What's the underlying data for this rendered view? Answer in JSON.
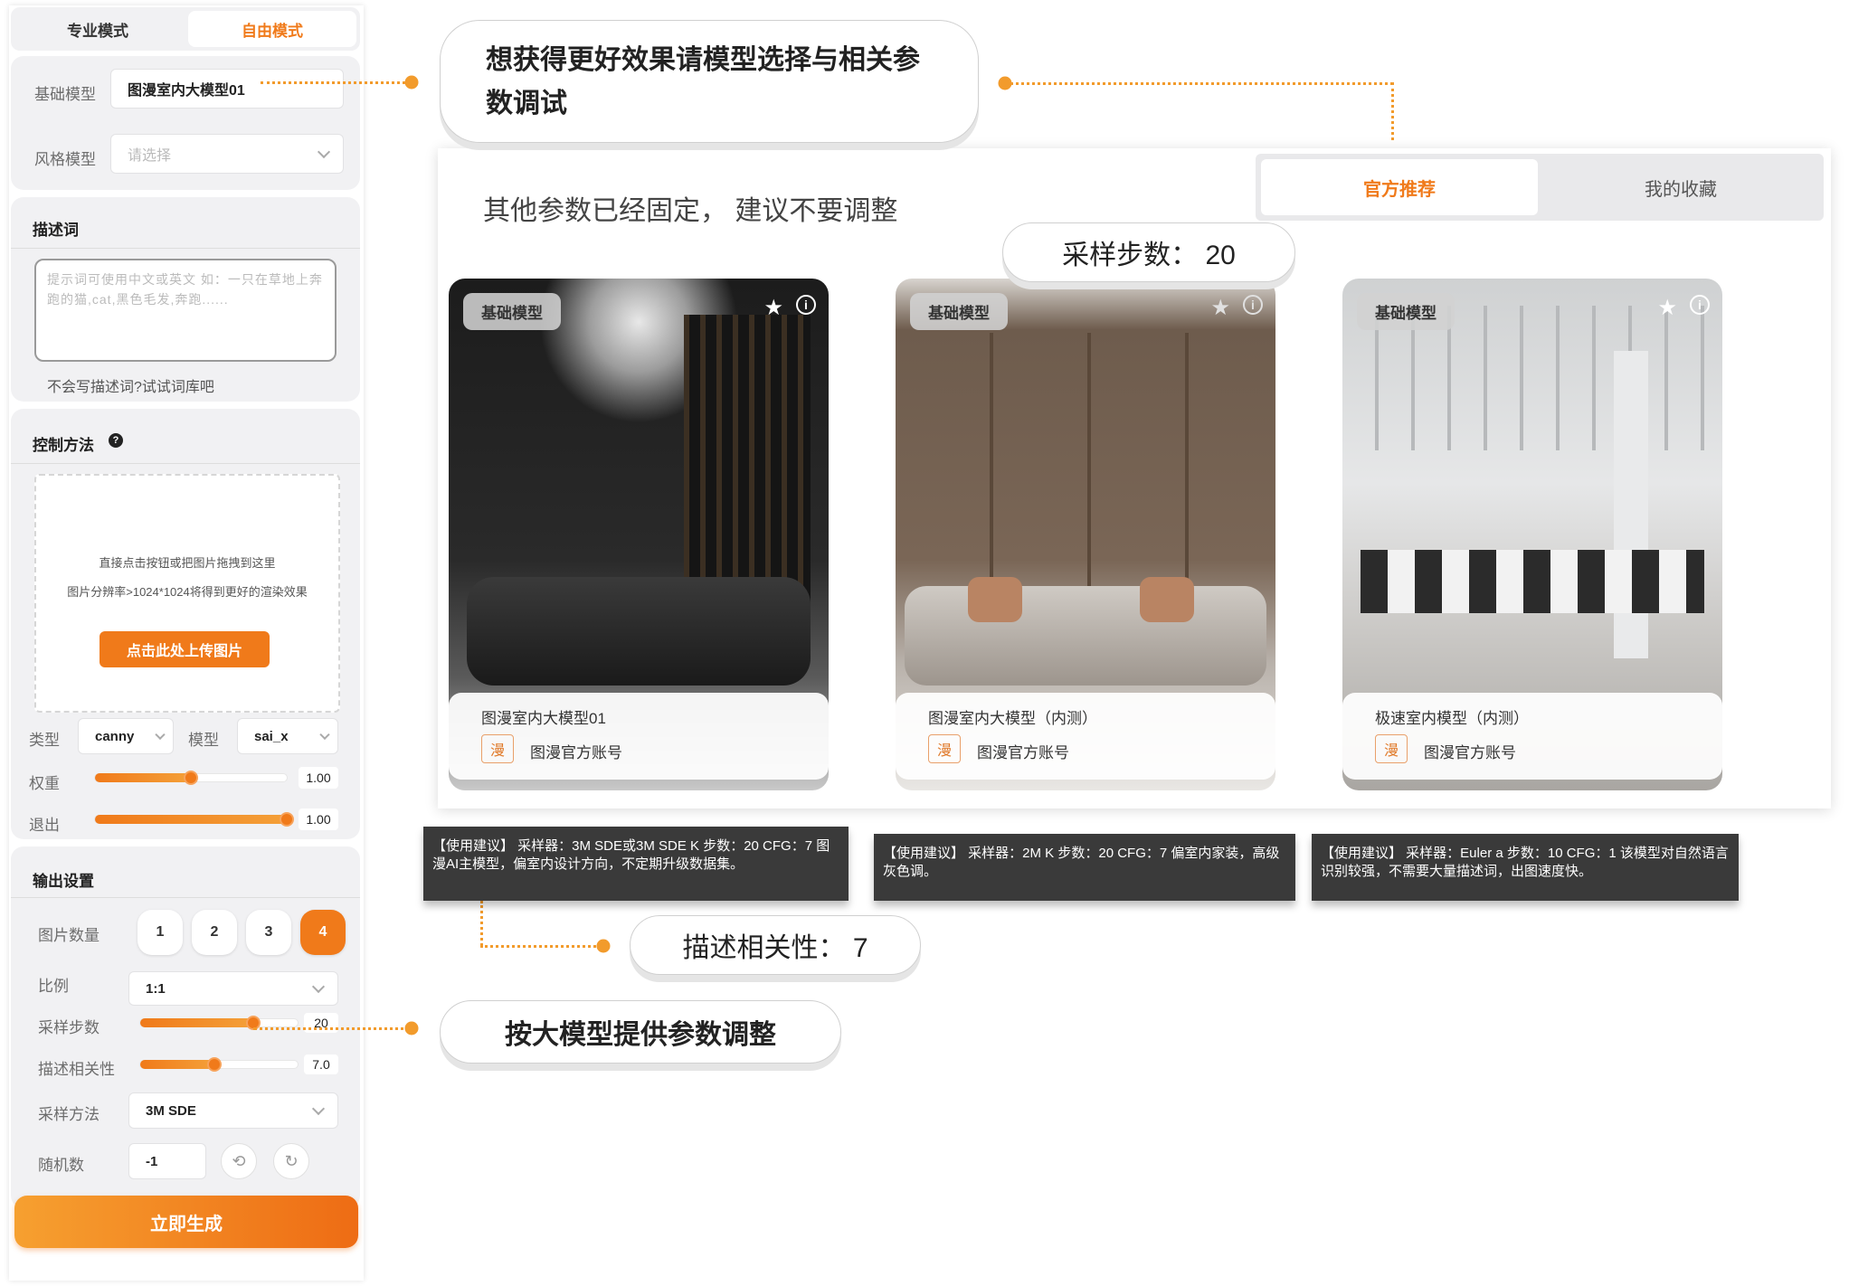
{
  "left_panel": {
    "tabs": {
      "pro": "专业模式",
      "free": "自由模式"
    },
    "base_model": {
      "label": "基础模型",
      "value": "图漫室内大模型01"
    },
    "style_model": {
      "label": "风格模型",
      "placeholder": "请选择"
    },
    "prompt": {
      "title": "描述词",
      "placeholder": "提示词可使用中文或英文 如：一只在草地上奔跑的猫,cat,黑色毛发,奔跑......",
      "help": "不会写描述词?试试词库吧"
    },
    "control": {
      "title": "控制方法",
      "help_icon": "?",
      "upload_hint1": "直接点击按钮或把图片拖拽到这里",
      "upload_hint2": "图片分辨率>1024*1024将得到更好的渲染效果",
      "upload_button": "点击此处上传图片",
      "type_label": "类型",
      "type_value": "canny",
      "model_label": "模型",
      "model_value": "sai_x",
      "weight_label": "权重",
      "weight_value": "1.00",
      "weight_fraction": 0.5,
      "exit_label": "退出",
      "exit_value": "1.00",
      "exit_fraction": 1.0
    },
    "output": {
      "title": "输出设置",
      "count_label": "图片数量",
      "count_options": [
        "1",
        "2",
        "3",
        "4"
      ],
      "count_selected": "4",
      "ratio_label": "比例",
      "ratio_value": "1:1",
      "steps_label": "采样步数",
      "steps_value": "20",
      "steps_fraction": 0.72,
      "relevance_label": "描述相关性",
      "relevance_value": "7.0",
      "relevance_fraction": 0.47,
      "sampler_label": "采样方法",
      "sampler_value": "3M SDE",
      "seed_label": "随机数",
      "seed_value": "-1"
    },
    "generate_button": "立即生成"
  },
  "callouts": {
    "top": "想获得更好效果请模型选择与相关参数调试",
    "steps": "采样步数：  20",
    "relevance": "描述相关性：  7",
    "adjust": "按大模型提供参数调整"
  },
  "main": {
    "note": "其他参数已经固定，  建议不要调整",
    "tabs": {
      "official": "官方推荐",
      "favorites": "我的收藏"
    },
    "accent_color": "#f07a1a",
    "cards": [
      {
        "tag": "基础模型",
        "name": "图漫室内大模型01",
        "account": "图漫官方账号",
        "tip": "【使用建议】 采样器：3M SDE或3M SDE K 步数：20 CFG：7 图漫AI主模型，偏室内设计方向，不定期升级数据集。"
      },
      {
        "tag": "基础模型",
        "name": "图漫室内大模型（内测）",
        "account": "图漫官方账号",
        "tip": "【使用建议】 采样器：2M K 步数：20 CFG：7 偏室内家装，高级灰色调。"
      },
      {
        "tag": "基础模型",
        "name": "极速室内模型（内测）",
        "account": "图漫官方账号",
        "tip": "【使用建议】 采样器：Euler a 步数：10 CFG：1 该模型对自然语言识别较强，不需要大量描述词，出图速度快。"
      }
    ]
  }
}
